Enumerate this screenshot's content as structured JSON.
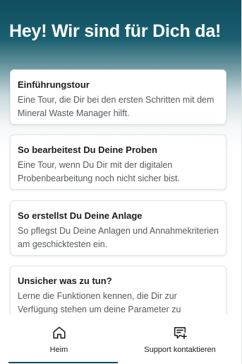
{
  "header": {
    "title": "Hey! Wir sind für Dich da!"
  },
  "cards": [
    {
      "title": "Einführungstour",
      "description": "Eine Tour, die Dir bei den ersten Schritten mit dem Mineral Waste Manager hilft."
    },
    {
      "title": "So bearbeitest Du Deine Proben",
      "description": "Eine Tour, wenn Du Dir mit der digitalen Probenbearbeitung noch nicht sicher bist."
    },
    {
      "title": "So erstellst Du Deine Anlage",
      "description": "So pflegst Du Deine Anlagen und Annahmekriterien am geschicktesten ein."
    },
    {
      "title": "Unsicher was zu tun?",
      "description": "Lerne die Funktionen kennen, die Dir zur Verfügung stehen um deine Parameter zu"
    }
  ],
  "bottom_nav": {
    "items": [
      {
        "label": "Heim",
        "icon": "home-icon",
        "active": true
      },
      {
        "label": "Support kontaktieren",
        "icon": "chat-add-icon",
        "active": false
      }
    ]
  },
  "colors": {
    "brand": "#0f4d5f",
    "card_border": "#e3e6e8",
    "text_primary": "#1d1d1f",
    "text_secondary": "#55595c"
  }
}
